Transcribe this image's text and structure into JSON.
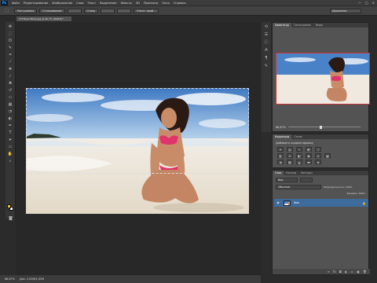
{
  "app": {
    "logo": "Ps"
  },
  "menu": [
    "Файл",
    "Редактирование",
    "Изображение",
    "Слои",
    "Текст",
    "Выделение",
    "Фильтр",
    "3D",
    "Просмотр",
    "Окно",
    "Справка"
  ],
  "window_controls": [
    "—",
    "□",
    "✕"
  ],
  "options": {
    "mode_buttons": [
      "Растушевка",
      "Сглаживание"
    ],
    "style_label": "Стиль",
    "refine_button": "Уточн. край...",
    "workspace": "Движение"
  },
  "document": {
    "tab_title": "CFT-BeachBody.jpg @ 66,7% (RGB/8)*",
    "zoom": "66,67%",
    "doc_info": "Док: 2,02M/2,02M"
  },
  "panels": {
    "navigator_tabs": [
      "Навигатор",
      "Гистограмма",
      "Инфо"
    ],
    "navigator_zoom": "66,67%",
    "adjust_tabs": [
      "Коррекция",
      "Стили"
    ],
    "adjust_title": "Добавить корректировку",
    "layers_tabs": [
      "Слои",
      "Каналы",
      "Контуры"
    ],
    "layers_kind": "Вид",
    "layers_blend": "Обычные",
    "layers_opacity_label": "Непрозрачность: 100%",
    "layers_fill_label": "Заливка: 100%",
    "layer_name": "Фон"
  },
  "colors": {
    "foreground": "#f0c23a",
    "background": "#ffffff",
    "layer_selected": "#3d6b9c"
  }
}
